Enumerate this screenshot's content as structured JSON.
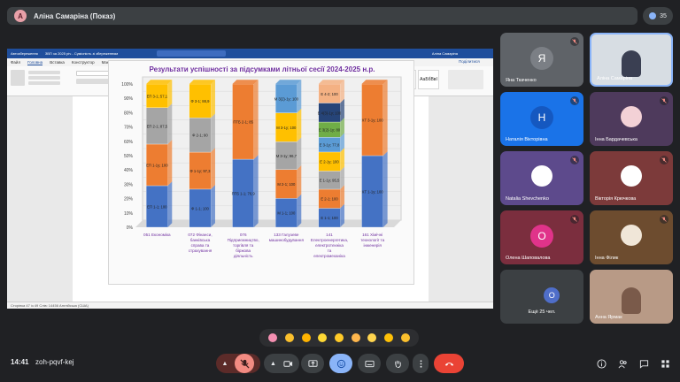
{
  "meeting": {
    "presenter_initial": "А",
    "presenter_title": "Аліна Самаріна (Показ)",
    "participants_count": "35",
    "time": "14:41",
    "code": "zoh-pqvf-kej"
  },
  "word": {
    "titlebar": [
      "Автозбереження",
      "ЗВП за 2025 річ - Сумісність зі збереженням",
      "Аліна Самаріна"
    ],
    "tabs": [
      "Файл",
      "Головна",
      "Вставка",
      "Конструктор",
      "Макет",
      "Посилання",
      "Розсилки",
      "Рецензування",
      "Вид",
      "Довідка",
      "ABBYY PDF Transformer+",
      "Конструктор таблиц",
      "Макет"
    ],
    "active_tab": "Головна",
    "share_label": "Поділитися",
    "styles": [
      "АаБбВвГг",
      "АаБбВ",
      "АаБбВвІ",
      "АаБбВ",
      "АаБбВвГ",
      "АаБ",
      "АаБбВІ",
      "АаБбВвІ"
    ],
    "status": "Сторінка 47 із 49    Слів: 14456    Англійська (США)"
  },
  "chart_data": {
    "type": "bar",
    "title": "Результати успішності за підсумками літньої сесії 2024-2025 н.р.",
    "ylim": [
      0,
      100
    ],
    "yticks": [
      "0%",
      "10%",
      "20%",
      "30%",
      "40%",
      "50%",
      "60%",
      "70%",
      "80%",
      "90%",
      "100%"
    ],
    "categories": [
      "051 Економіка",
      "072 Фінанси, банківська справа та страхування",
      "076 Підприємництво, торгівля та біржова діяльність",
      "133 Галузеве машинобудування",
      "141 Електроенергетика, електротехніка та електромеханіка",
      "161 Хімічні технології та інженерія"
    ],
    "stacks": [
      [
        {
          "label": "ЕП 1-1; 100",
          "value": 100,
          "color": "#4472c4"
        },
        {
          "label": "ЕП 1-1у; 100",
          "value": 100,
          "color": "#ed7d31"
        },
        {
          "label": "ЕП 2-1; 87,5",
          "value": 87.5,
          "color": "#a5a5a5"
        },
        {
          "label": "ЕП 3-1; 57,1",
          "value": 57.1,
          "color": "#ffc000"
        }
      ],
      [
        {
          "label": "Ф 1-1; 100",
          "value": 100,
          "color": "#4472c4"
        },
        {
          "label": "Ф 1-1у; 97,3",
          "value": 97.3,
          "color": "#ed7d31"
        },
        {
          "label": "Ф 2-1; 90",
          "value": 90,
          "color": "#a5a5a5"
        },
        {
          "label": "Ф 3-1; 88,9",
          "value": 88.9,
          "color": "#ffc000"
        }
      ],
      [
        {
          "label": "ПТБ 1-1; 76,9",
          "value": 76.9,
          "color": "#4472c4"
        },
        {
          "label": "ПТБ 2-1; 85",
          "value": 85,
          "color": "#ed7d31"
        }
      ],
      [
        {
          "label": "М 1-1; 100",
          "value": 100,
          "color": "#4472c4"
        },
        {
          "label": "М 2-1; 100",
          "value": 100,
          "color": "#ed7d31"
        },
        {
          "label": "М 3-1у; 96,7",
          "value": 96.7,
          "color": "#a5a5a5"
        },
        {
          "label": "М 3-1у; 100",
          "value": 100,
          "color": "#ffc000"
        },
        {
          "label": "М 3(2)-1у; 100",
          "value": 100,
          "color": "#5b9bd5"
        }
      ],
      [
        {
          "label": "Е 1-1; 100",
          "value": 100,
          "color": "#4472c4"
        },
        {
          "label": "Е 2-1; 100",
          "value": 100,
          "color": "#ed7d31"
        },
        {
          "label": "Е 1-1у; 95,5",
          "value": 95.5,
          "color": "#a5a5a5"
        },
        {
          "label": "Е 2-1у; 100",
          "value": 100,
          "color": "#ffc000"
        },
        {
          "label": "Е 3-1у; 77,8",
          "value": 77.8,
          "color": "#5b9bd5"
        },
        {
          "label": "Е 3(2)-1у; 80",
          "value": 80,
          "color": "#70ad47"
        },
        {
          "label": "Е 4(3)-1у; 100",
          "value": 100,
          "color": "#264478"
        },
        {
          "label": "Е 4-2; 100",
          "value": 100,
          "color": "#f4b183"
        }
      ],
      [
        {
          "label": "ХТ 1-1у; 100",
          "value": 100,
          "color": "#4472c4"
        },
        {
          "label": "ХТ 3-1у; 100",
          "value": 100,
          "color": "#ed7d31"
        }
      ]
    ]
  },
  "participants": [
    {
      "name": "Яна Ткаченко",
      "initial": "Я",
      "bg": "#5f6368",
      "muted": true
    },
    {
      "name": "Аліна Самаріна",
      "initial": "",
      "bg": "#d7dde3",
      "muted": false
    },
    {
      "name": "Наталія Вікторівна",
      "initial": "Н",
      "bg": "#1a73e8",
      "muted": true
    },
    {
      "name": "Інна Бардачевська",
      "initial": "",
      "bg": "#4e3a5c",
      "muted": true
    },
    {
      "name": "Natalia Shevchenko",
      "initial": "",
      "bg": "#5d4a8c",
      "muted": true
    },
    {
      "name": "Вікторія Крючкова",
      "initial": "",
      "bg": "#7c3a3a",
      "muted": true
    },
    {
      "name": "Олена Шаповалова",
      "initial": "О",
      "bg": "#7b2e3e",
      "muted": true
    },
    {
      "name": "Інна Філик",
      "initial": "",
      "bg": "#6d4c2f",
      "muted": true
    },
    {
      "name": "Ещё 25 чел.",
      "initial": "О",
      "bg": "#3c4043",
      "muted": false
    },
    {
      "name": "Анна Ярмак",
      "initial": "",
      "bg": "#b89a86",
      "muted": false
    }
  ],
  "reactions": [
    "heart",
    "thumbs-up",
    "party",
    "clap",
    "laugh",
    "surprised",
    "sad",
    "thinking",
    "thumbs-down"
  ]
}
